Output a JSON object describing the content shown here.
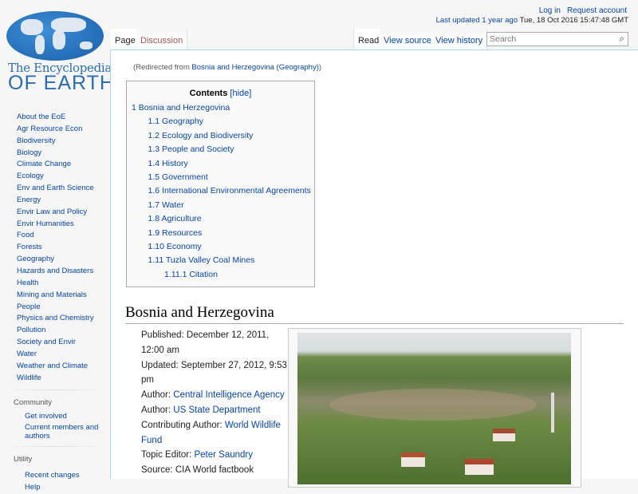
{
  "logo": {
    "line1": "The Encyclopedia",
    "line2": "OF EARTH"
  },
  "personal": {
    "login": "Log in",
    "request": "Request account"
  },
  "updated": {
    "link": "Last updated 1 year ago",
    "date": "Tue, 18 Oct 2016 15:47:48 GMT"
  },
  "tabs": {
    "page": "Page",
    "discussion": "Discussion",
    "read": "Read",
    "view_source": "View source",
    "view_history": "View history"
  },
  "search": {
    "placeholder": "Search"
  },
  "sidebar": {
    "items": [
      "About the EoE",
      "Agr Resource Econ",
      "Biodiversity",
      "Biology",
      "Climate Change",
      "Ecology",
      "Env and Earth Science",
      "Energy",
      "Envir Law and Policy",
      "Envir Humanities",
      "Food",
      "Forests",
      "Geography",
      "Hazards and Disasters",
      "Health",
      "Mining and Materials",
      "People",
      "Physics and Chemistry",
      "Pollution",
      "Society and Envir",
      "Water",
      "Weather and Climate",
      "Wildlife"
    ],
    "community": {
      "heading": "Community",
      "items": [
        "Get involved",
        "Current members and authors"
      ]
    },
    "utility": {
      "heading": "Utility",
      "items": [
        "Recent changes",
        "Help"
      ]
    }
  },
  "redirect": {
    "prefix": "(Redirected from ",
    "link": "Bosnia and Herzegovina (Geography)",
    "suffix": ")"
  },
  "toc": {
    "title": "Contents",
    "hide": "[hide]",
    "items": [
      {
        "num": "1",
        "text": "Bosnia and Herzegovina"
      },
      {
        "num": "1.1",
        "text": "Geography"
      },
      {
        "num": "1.2",
        "text": "Ecology and Biodiversity"
      },
      {
        "num": "1.3",
        "text": "People and Society"
      },
      {
        "num": "1.4",
        "text": "History"
      },
      {
        "num": "1.5",
        "text": "Government"
      },
      {
        "num": "1.6",
        "text": "International Environmental Agreements"
      },
      {
        "num": "1.7",
        "text": "Water"
      },
      {
        "num": "1.8",
        "text": "Agriculture"
      },
      {
        "num": "1.9",
        "text": "Resources"
      },
      {
        "num": "1.10",
        "text": "Economy"
      },
      {
        "num": "1.11",
        "text": "Tuzla Valley Coal Mines"
      },
      {
        "num": "1.11.1",
        "text": "Citation"
      }
    ]
  },
  "heading": "Bosnia and Herzegovina",
  "meta": {
    "published_label": "Published:",
    "published": "December 12, 2011, 12:00 am",
    "updated_label": "Updated:",
    "updated": "September 27, 2012, 9:53 pm",
    "author_label": "Author:",
    "author1": "Central Intelligence Agency",
    "author2": "US State Department",
    "contrib_label": "Contributing Author:",
    "contrib": "World Wildlife Fund",
    "editor_label": "Topic Editor:",
    "editor": "Peter Saundry",
    "source_label": "Source:",
    "source": "CIA World factbook"
  }
}
